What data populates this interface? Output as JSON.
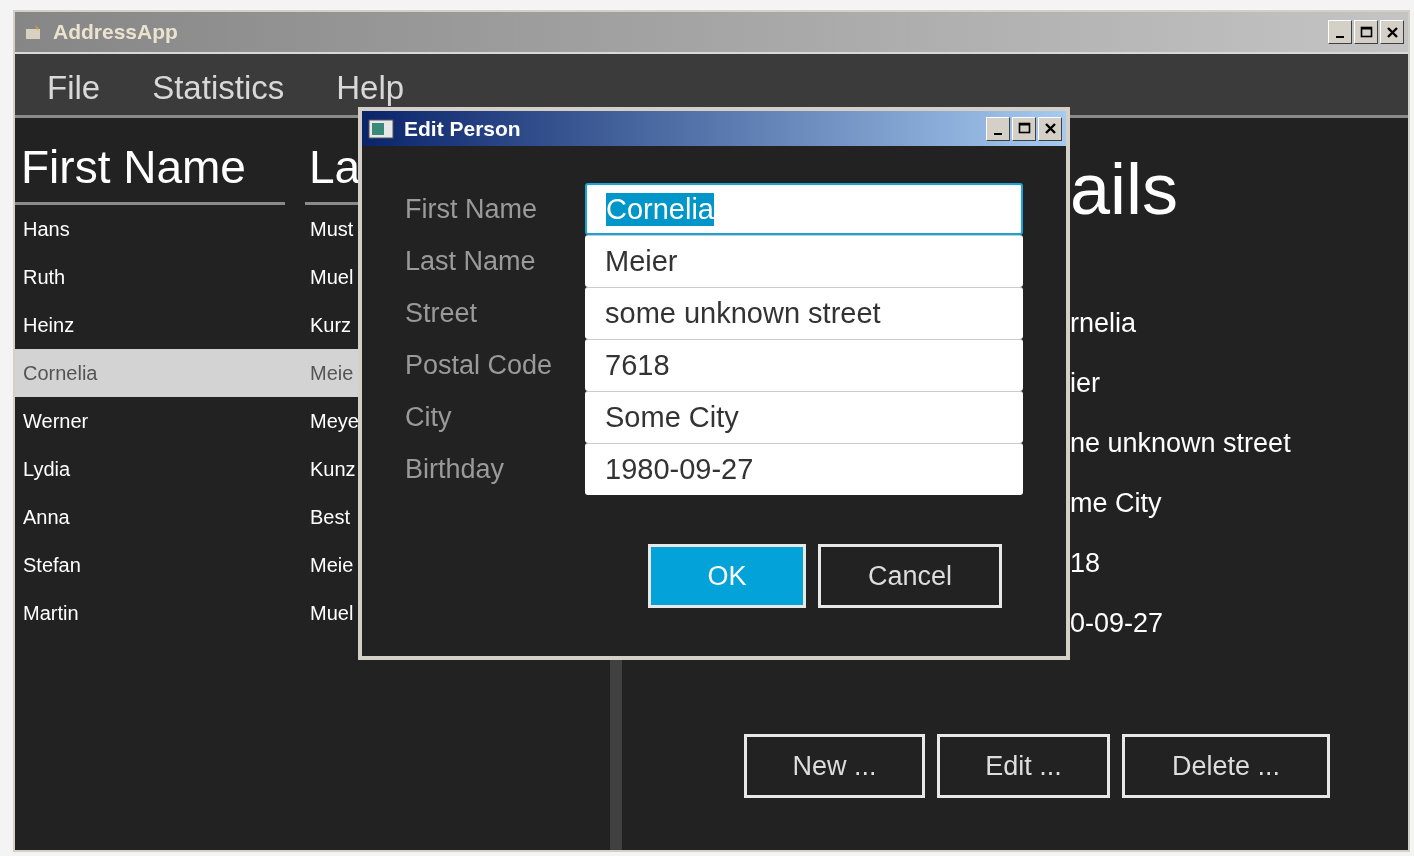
{
  "window": {
    "title": "AddressApp"
  },
  "menu": [
    {
      "label": "File"
    },
    {
      "label": "Statistics"
    },
    {
      "label": "Help"
    }
  ],
  "table": {
    "columns": [
      "First Name",
      "La"
    ],
    "rows": [
      {
        "first_name": "Hans",
        "last_name": "Must",
        "selected": false
      },
      {
        "first_name": "Ruth",
        "last_name": "Muel",
        "selected": false
      },
      {
        "first_name": "Heinz",
        "last_name": "Kurz",
        "selected": false
      },
      {
        "first_name": "Cornelia",
        "last_name": "Meie",
        "selected": true
      },
      {
        "first_name": "Werner",
        "last_name": "Meye",
        "selected": false
      },
      {
        "first_name": "Lydia",
        "last_name": "Kunz",
        "selected": false
      },
      {
        "first_name": "Anna",
        "last_name": "Best",
        "selected": false
      },
      {
        "first_name": "Stefan",
        "last_name": "Meie",
        "selected": false
      },
      {
        "first_name": "Martin",
        "last_name": "Muel",
        "selected": false
      }
    ]
  },
  "details": {
    "title": "ails",
    "values": [
      "rnelia",
      "ier",
      "ne unknown street",
      "me City",
      "18",
      "0-09-27"
    ]
  },
  "actions": [
    "New ...",
    "Edit ...",
    "Delete ..."
  ],
  "dialog": {
    "title": "Edit Person",
    "fields": [
      {
        "label": "First Name",
        "value": "Cornelia",
        "focused": true
      },
      {
        "label": "Last Name",
        "value": "Meier",
        "focused": false
      },
      {
        "label": "Street",
        "value": "some unknown street",
        "focused": false
      },
      {
        "label": "Postal Code",
        "value": "7618",
        "focused": false
      },
      {
        "label": "City",
        "value": "Some City",
        "focused": false
      },
      {
        "label": "Birthday",
        "value": "1980-09-27",
        "focused": false
      }
    ],
    "buttons": [
      {
        "label": "OK",
        "default": true
      },
      {
        "label": "Cancel",
        "default": false
      }
    ]
  }
}
